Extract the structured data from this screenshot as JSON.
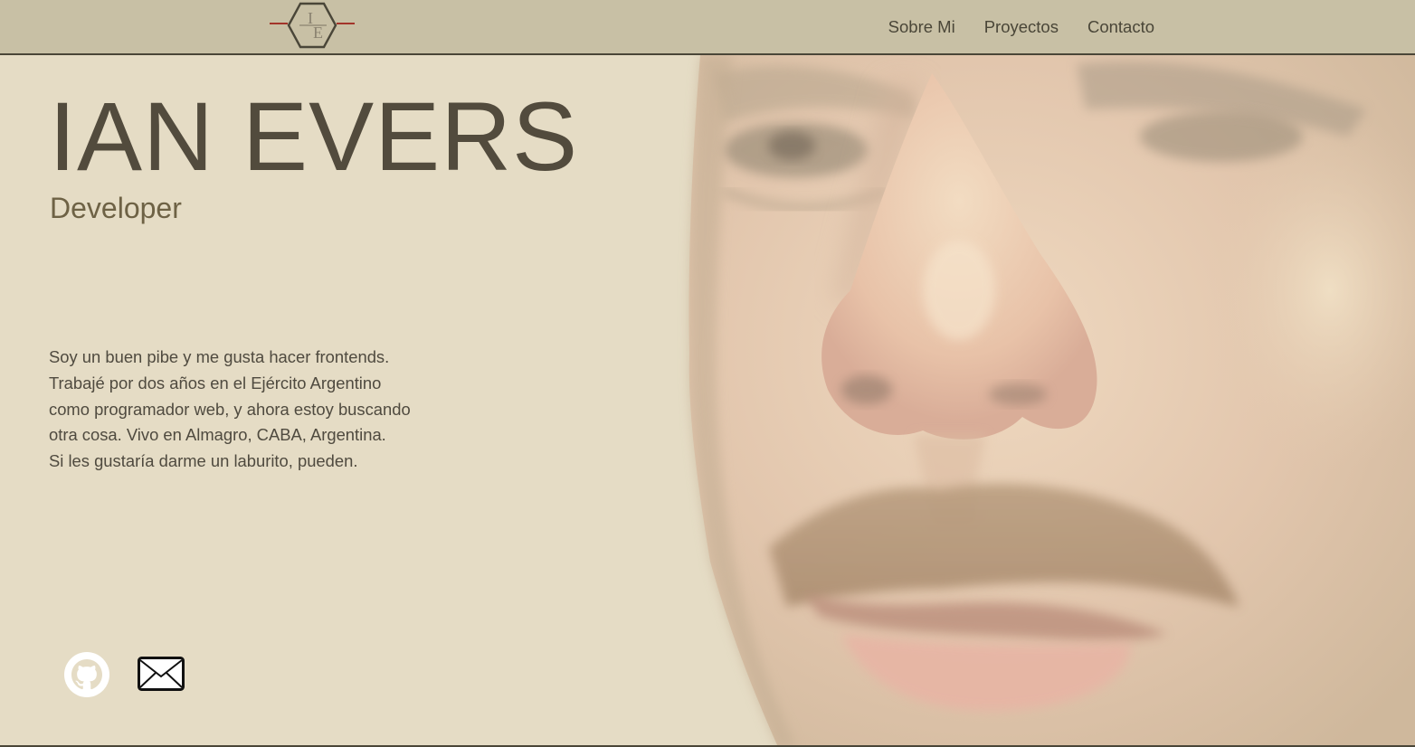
{
  "header": {
    "logo_letters": [
      "I",
      "E"
    ],
    "nav": [
      {
        "label": "Sobre Mi"
      },
      {
        "label": "Proyectos"
      },
      {
        "label": "Contacto"
      }
    ]
  },
  "hero": {
    "name": "IAN EVERS",
    "role": "Developer",
    "bio": [
      "Soy un buen pibe y me gusta hacer frontends.",
      "Trabajé por dos años en el Ejército Argentino",
      "como programador web, y ahora estoy buscando",
      "otra cosa. Vivo en Almagro, CABA, Argentina.",
      "Si les gustaría darme un laburito, pueden."
    ]
  },
  "social": {
    "icons": [
      "github-icon",
      "mail-icon"
    ]
  },
  "colors": {
    "background": "#e5dcc5",
    "header": "#c8c0a5",
    "text_dark": "#524b3d",
    "role_text": "#6e6245",
    "logo_accent": "#a3352a"
  }
}
